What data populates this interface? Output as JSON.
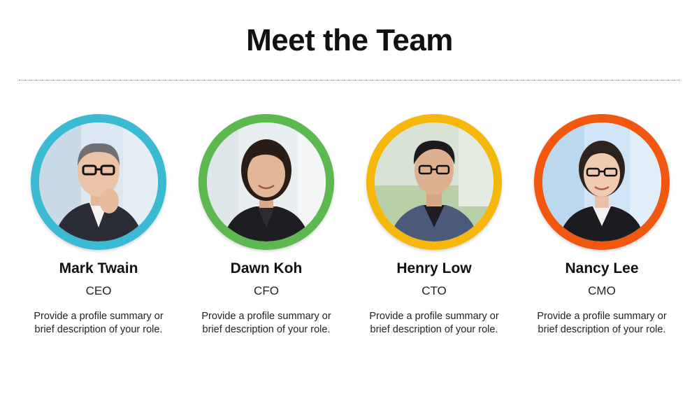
{
  "page": {
    "title": "Meet the Team"
  },
  "members": [
    {
      "name": "Mark Twain",
      "role": "CEO",
      "description": "Provide a profile summary or brief description of your role.",
      "ring_color": "#3bbbd3",
      "photo_icon": "man-portrait-icon"
    },
    {
      "name": "Dawn Koh",
      "role": "CFO",
      "description": "Provide a profile summary or brief description of your role.",
      "ring_color": "#5cb84f",
      "photo_icon": "woman-portrait-icon"
    },
    {
      "name": "Henry Low",
      "role": "CTO",
      "description": "Provide a profile summary or brief description of your role.",
      "ring_color": "#f5b70a",
      "photo_icon": "man-portrait-icon"
    },
    {
      "name": "Nancy Lee",
      "role": "CMO",
      "description": "Provide a profile summary or brief description of your role.",
      "ring_color": "#f2570f",
      "photo_icon": "woman-portrait-icon"
    }
  ]
}
